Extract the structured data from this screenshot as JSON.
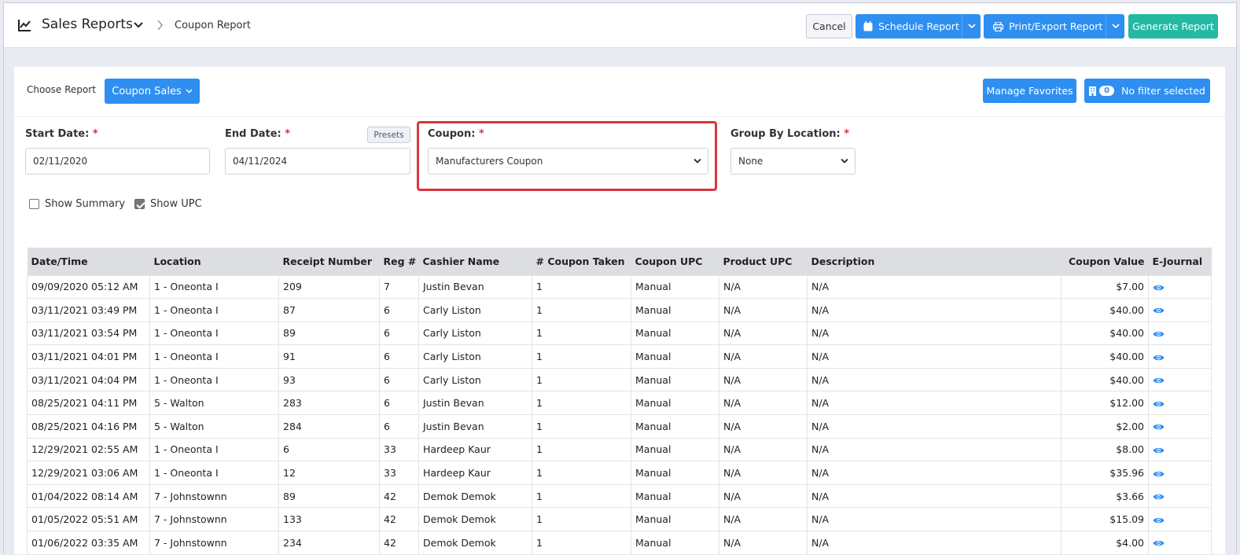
{
  "header": {
    "title": "Sales Reports",
    "breadcrumb": "Coupon Report",
    "buttons": {
      "cancel": "Cancel",
      "schedule": "Schedule Report",
      "print_export": "Print/Export Report",
      "generate": "Generate Report"
    }
  },
  "toolbar": {
    "choose_report_label": "Choose Report",
    "report_type": "Coupon Sales",
    "manage_favorites": "Manage Favorites",
    "filter_count": "0",
    "filter_label": "No filter selected"
  },
  "filters": {
    "start_date_label": "Start Date:",
    "start_date": "02/11/2020",
    "end_date_label": "End Date:",
    "end_date": "04/11/2024",
    "presets": "Presets",
    "coupon_label": "Coupon:",
    "coupon_value": "Manufacturers Coupon",
    "group_label": "Group By Location:",
    "group_value": "None",
    "required_mark": "*",
    "show_summary_label": "Show Summary",
    "show_summary": false,
    "show_upc_label": "Show UPC",
    "show_upc": true
  },
  "table": {
    "columns": [
      "Date/Time",
      "Location",
      "Receipt Number",
      "Reg #",
      "Cashier Name",
      "# Coupon Taken",
      "Coupon UPC",
      "Product UPC",
      "Description",
      "Coupon Value",
      "E-Journal"
    ],
    "rows": [
      [
        "09/09/2020 05:12 AM",
        "1 - Oneonta I",
        "209",
        "7",
        "Justin Bevan",
        "1",
        "Manual",
        "N/A",
        "N/A",
        "$7.00"
      ],
      [
        "03/11/2021 03:49 PM",
        "1 - Oneonta I",
        "87",
        "6",
        "Carly Liston",
        "1",
        "Manual",
        "N/A",
        "N/A",
        "$40.00"
      ],
      [
        "03/11/2021 03:54 PM",
        "1 - Oneonta I",
        "89",
        "6",
        "Carly Liston",
        "1",
        "Manual",
        "N/A",
        "N/A",
        "$40.00"
      ],
      [
        "03/11/2021 04:01 PM",
        "1 - Oneonta I",
        "91",
        "6",
        "Carly Liston",
        "1",
        "Manual",
        "N/A",
        "N/A",
        "$40.00"
      ],
      [
        "03/11/2021 04:04 PM",
        "1 - Oneonta I",
        "93",
        "6",
        "Carly Liston",
        "1",
        "Manual",
        "N/A",
        "N/A",
        "$40.00"
      ],
      [
        "08/25/2021 04:11 PM",
        "5 - Walton",
        "283",
        "6",
        "Justin Bevan",
        "1",
        "Manual",
        "N/A",
        "N/A",
        "$12.00"
      ],
      [
        "08/25/2021 04:16 PM",
        "5 - Walton",
        "284",
        "6",
        "Justin Bevan",
        "1",
        "Manual",
        "N/A",
        "N/A",
        "$2.00"
      ],
      [
        "12/29/2021 02:55 AM",
        "1 - Oneonta I",
        "6",
        "33",
        "Hardeep Kaur",
        "1",
        "Manual",
        "N/A",
        "N/A",
        "$8.00"
      ],
      [
        "12/29/2021 03:06 AM",
        "1 - Oneonta I",
        "12",
        "33",
        "Hardeep Kaur",
        "1",
        "Manual",
        "N/A",
        "N/A",
        "$35.96"
      ],
      [
        "01/04/2022 08:14 AM",
        "7 - Johnstownn",
        "89",
        "42",
        "Demok Demok",
        "1",
        "Manual",
        "N/A",
        "N/A",
        "$3.66"
      ],
      [
        "01/05/2022 05:51 AM",
        "7 - Johnstownn",
        "133",
        "42",
        "Demok Demok",
        "1",
        "Manual",
        "N/A",
        "N/A",
        "$15.09"
      ],
      [
        "01/06/2022 03:35 AM",
        "7 - Johnstownn",
        "234",
        "42",
        "Demok Demok",
        "1",
        "Manual",
        "N/A",
        "N/A",
        "$4.00"
      ]
    ]
  },
  "colors": {
    "primary": "#2e8ff1",
    "generate": "#25b9a4",
    "highlight": "#d9363e",
    "eye_icon": "#2e8ff1"
  }
}
